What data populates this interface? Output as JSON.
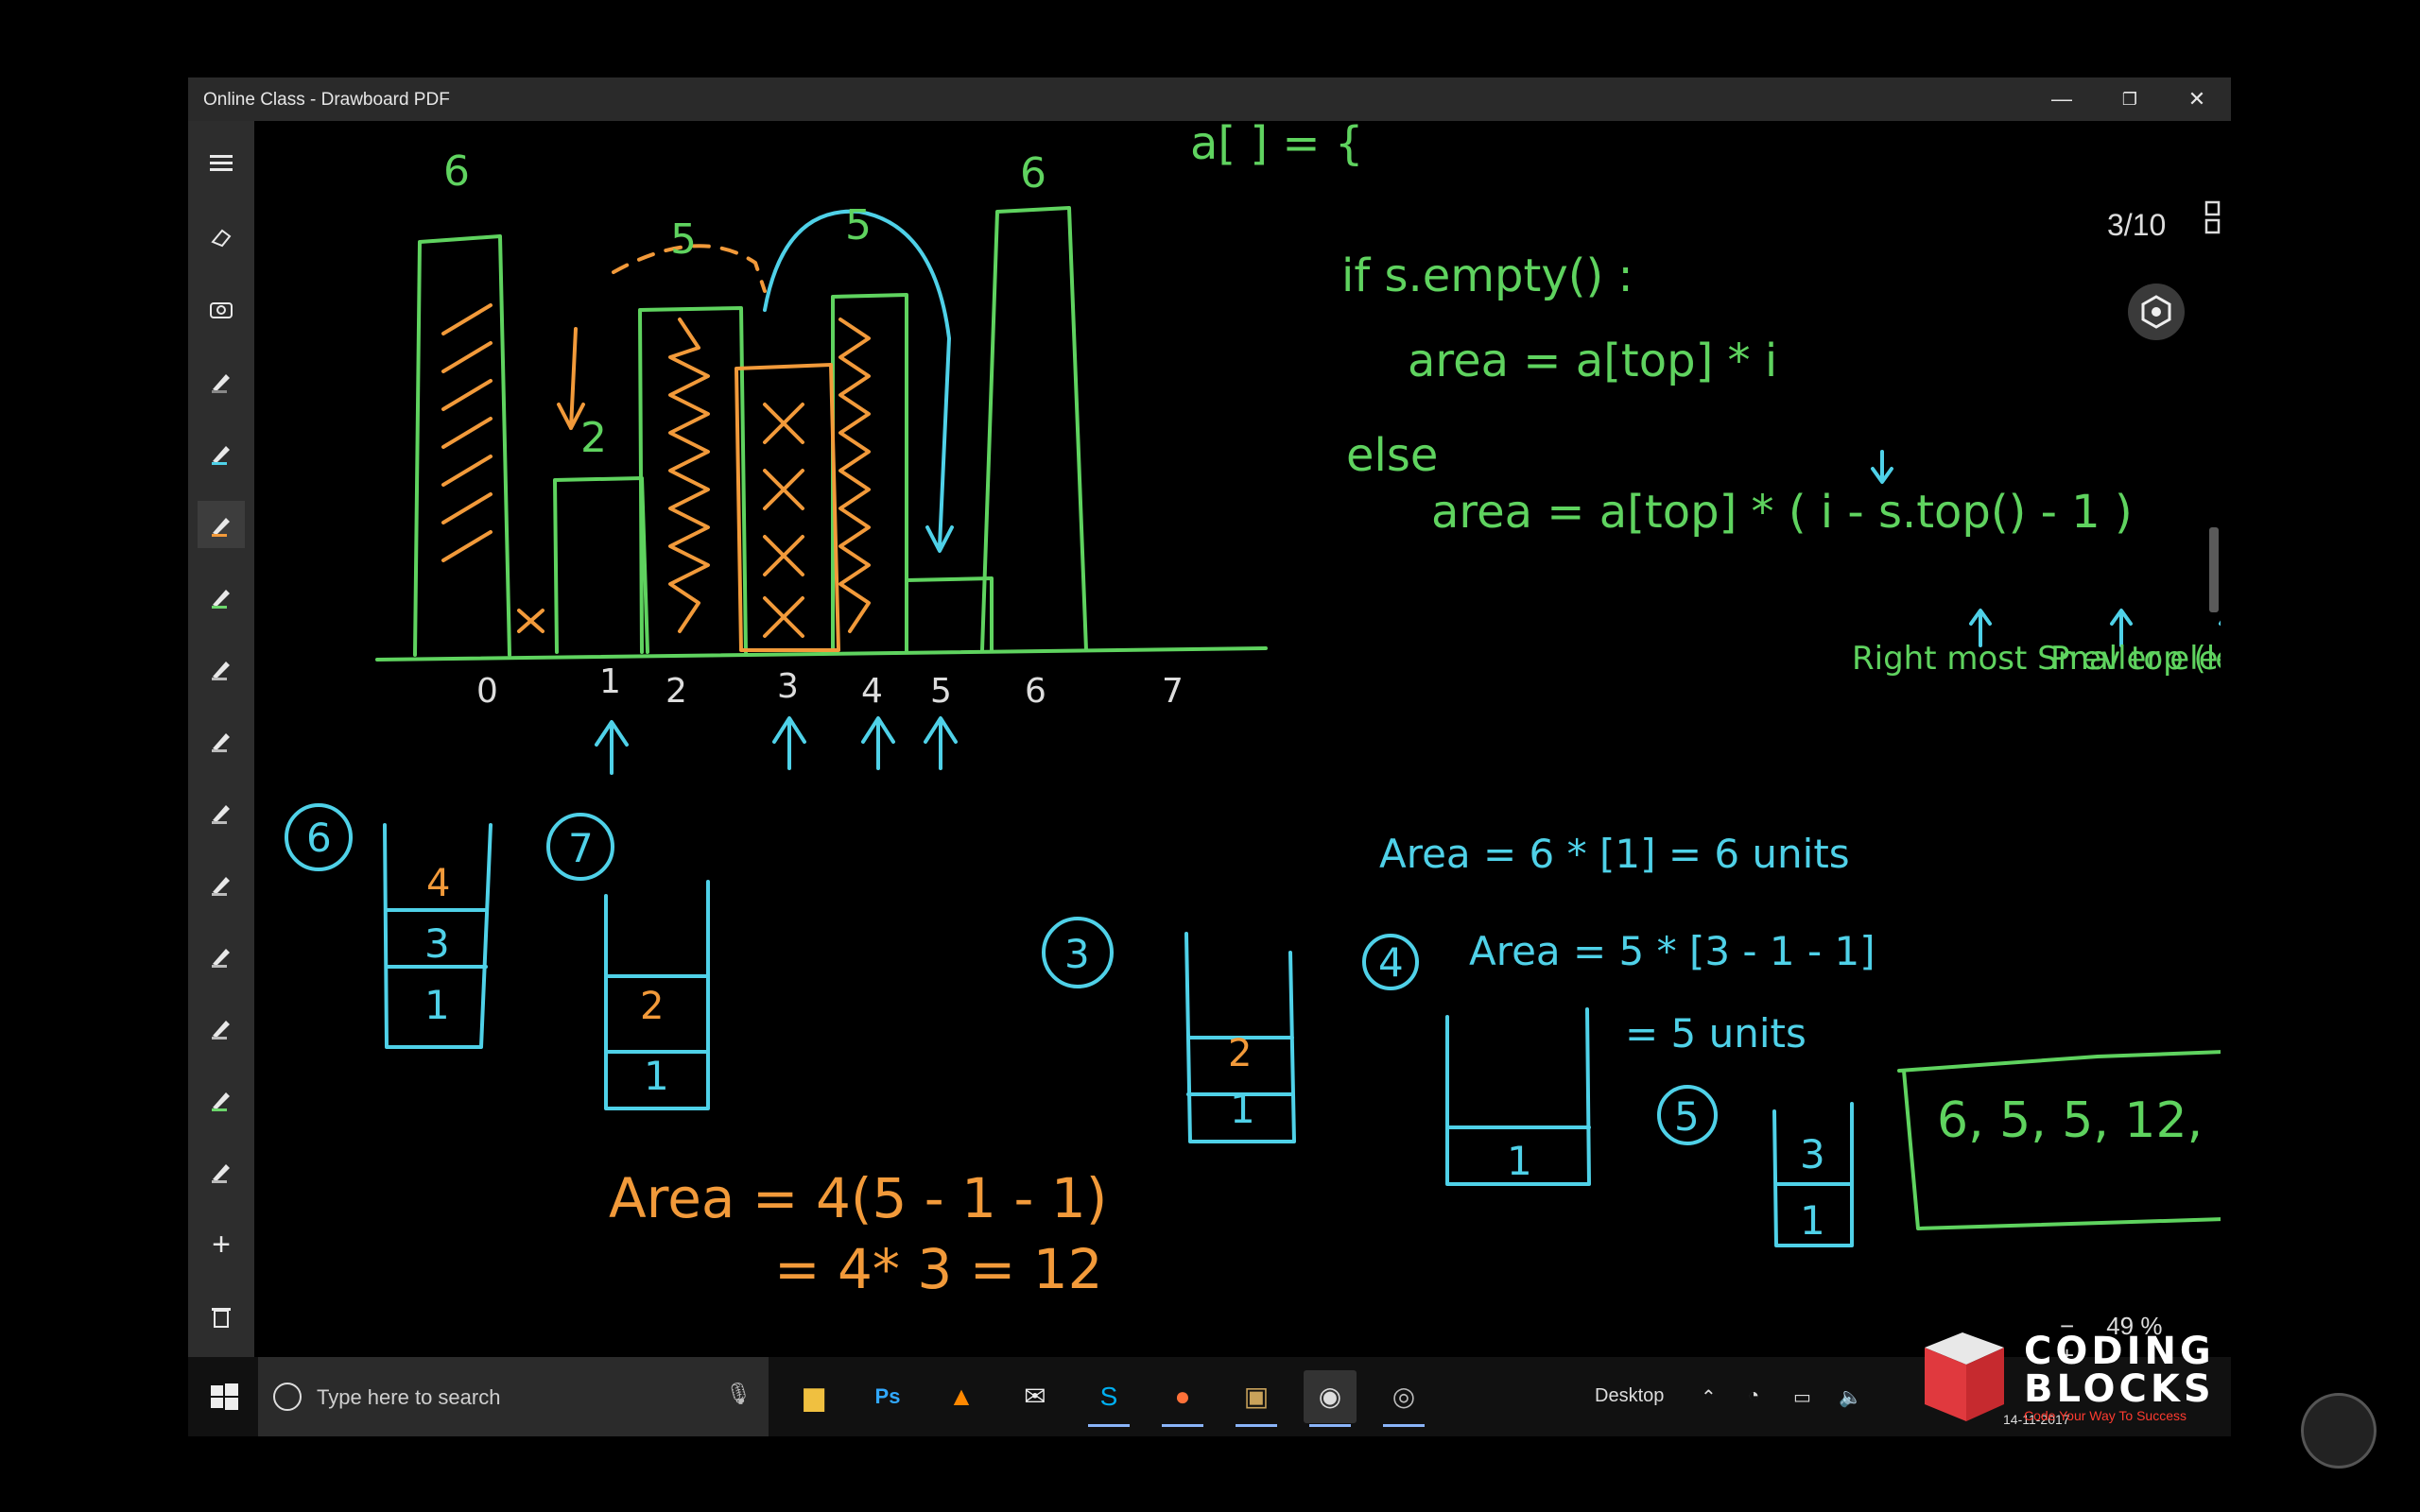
{
  "window": {
    "title": "Online Class - Drawboard PDF",
    "minimize": "—",
    "restore": "❐",
    "close": "✕"
  },
  "toolbar": {
    "items": [
      "menu",
      "eraser",
      "camera",
      "pen",
      "pen",
      "pen",
      "pen",
      "pen",
      "pen",
      "pen",
      "pen",
      "pen",
      "pen",
      "pen",
      "add",
      "delete",
      "undo-redo"
    ]
  },
  "viewer": {
    "page_current": "3",
    "page_sep": "/",
    "page_total": "10",
    "zoom_minus": "−",
    "zoom_value": "49 %",
    "zoom_plus": "+"
  },
  "whiteboard": {
    "heights_top": [
      "6",
      "5",
      "5",
      "6"
    ],
    "height_label_2": "2",
    "indices": [
      "0",
      "1",
      "2",
      "3",
      "4",
      "5",
      "6",
      "7"
    ],
    "array_fragment": "a[ ] = { ",
    "if_line": "if s.empty() :",
    "area_line1": "area = a[top] * i",
    "else": "else",
    "area_line2": "area = a[top] * ( i - s.top() - 1 )",
    "note_right": "Right most Smaller element",
    "note_prev": "Prev top (leftmost)",
    "step6": "6",
    "step7": "7",
    "step3": "3",
    "step4": "4",
    "step5": "5",
    "stack6": [
      "4",
      "3",
      "1"
    ],
    "stack7": [
      "2",
      "1"
    ],
    "stack3": [
      "2",
      "1"
    ],
    "stack4": [
      "1"
    ],
    "stack5": [
      "3",
      "1"
    ],
    "area_main": "Area = 6 * [1] = 6 units",
    "area4": "Area = 5 * [3 - 1 - 1]",
    "area4b": "= 5 units",
    "area_bottom": "Area = 4(5 - 1 - 1)",
    "area_bottom2": "= 4* 3 = 12",
    "result_box": "6, 5, 5, 12,"
  },
  "taskbar": {
    "search_placeholder": "Type here to search",
    "desktop_label": "Desktop",
    "date_fragment": "14-11-2017"
  },
  "branding": {
    "logo_line1": "CODING",
    "logo_line2": "BLOCKS",
    "tagline": "Code Your Way To Success"
  }
}
